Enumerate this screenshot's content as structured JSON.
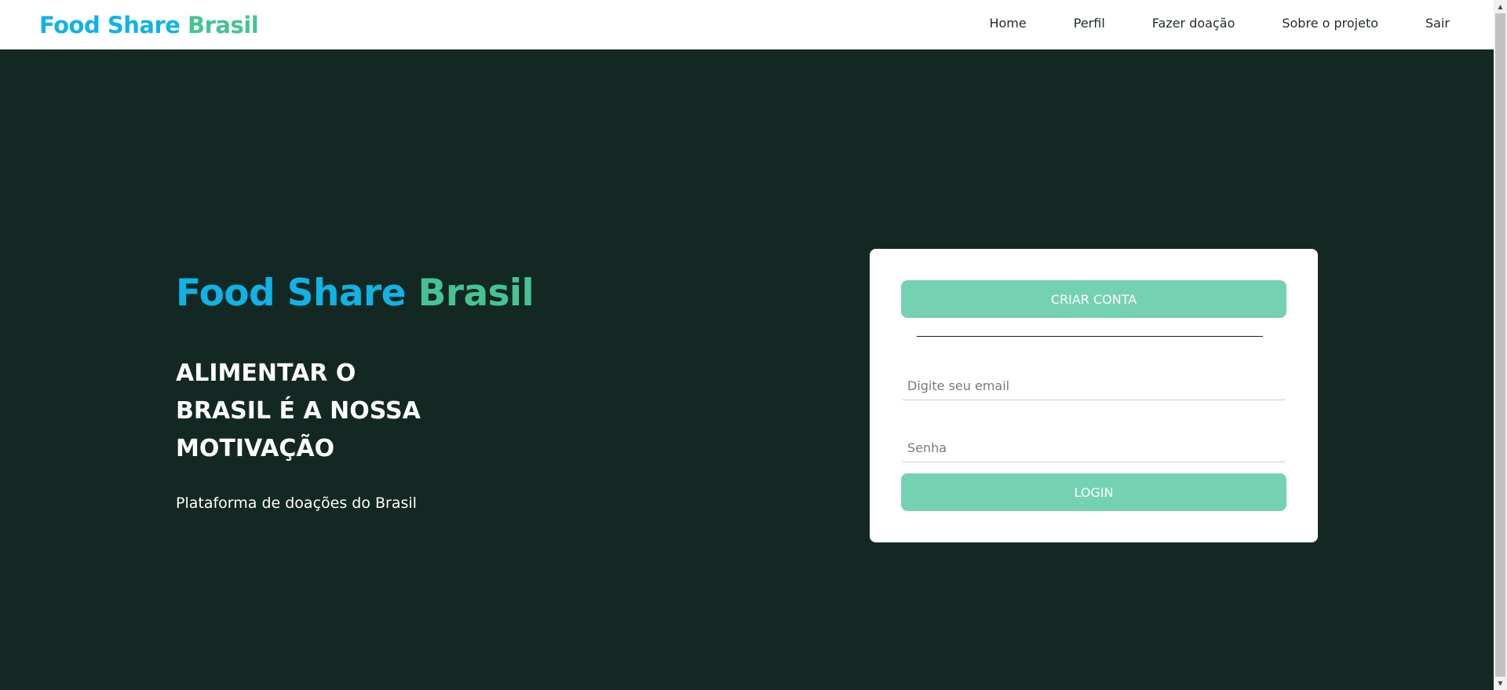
{
  "navbar": {
    "brand_part1": "Food Share",
    "brand_part2": "Brasil",
    "links": [
      {
        "label": "Home"
      },
      {
        "label": "Perfil"
      },
      {
        "label": "Fazer doação"
      },
      {
        "label": "Sobre o projeto"
      },
      {
        "label": "Sair"
      }
    ]
  },
  "hero": {
    "title_part1": "Food Share",
    "title_part2": "Brasil",
    "tagline": "ALIMENTAR O BRASIL É A NOSSA MOTIVAÇÃO",
    "subtitle": "Plataforma de doações do Brasil"
  },
  "login_card": {
    "create_account_label": "CRIAR CONTA",
    "email_placeholder": "Digite seu email",
    "password_placeholder": "Senha",
    "login_label": "LOGIN"
  },
  "colors": {
    "brand_blue": "#0fb3e6",
    "brand_green": "#45c394",
    "hero_background": "#132822",
    "button_green": "#74d2b2"
  },
  "icons": {
    "scroll_up": "scroll-up-arrow-icon",
    "scroll_down": "scroll-down-arrow-icon"
  }
}
